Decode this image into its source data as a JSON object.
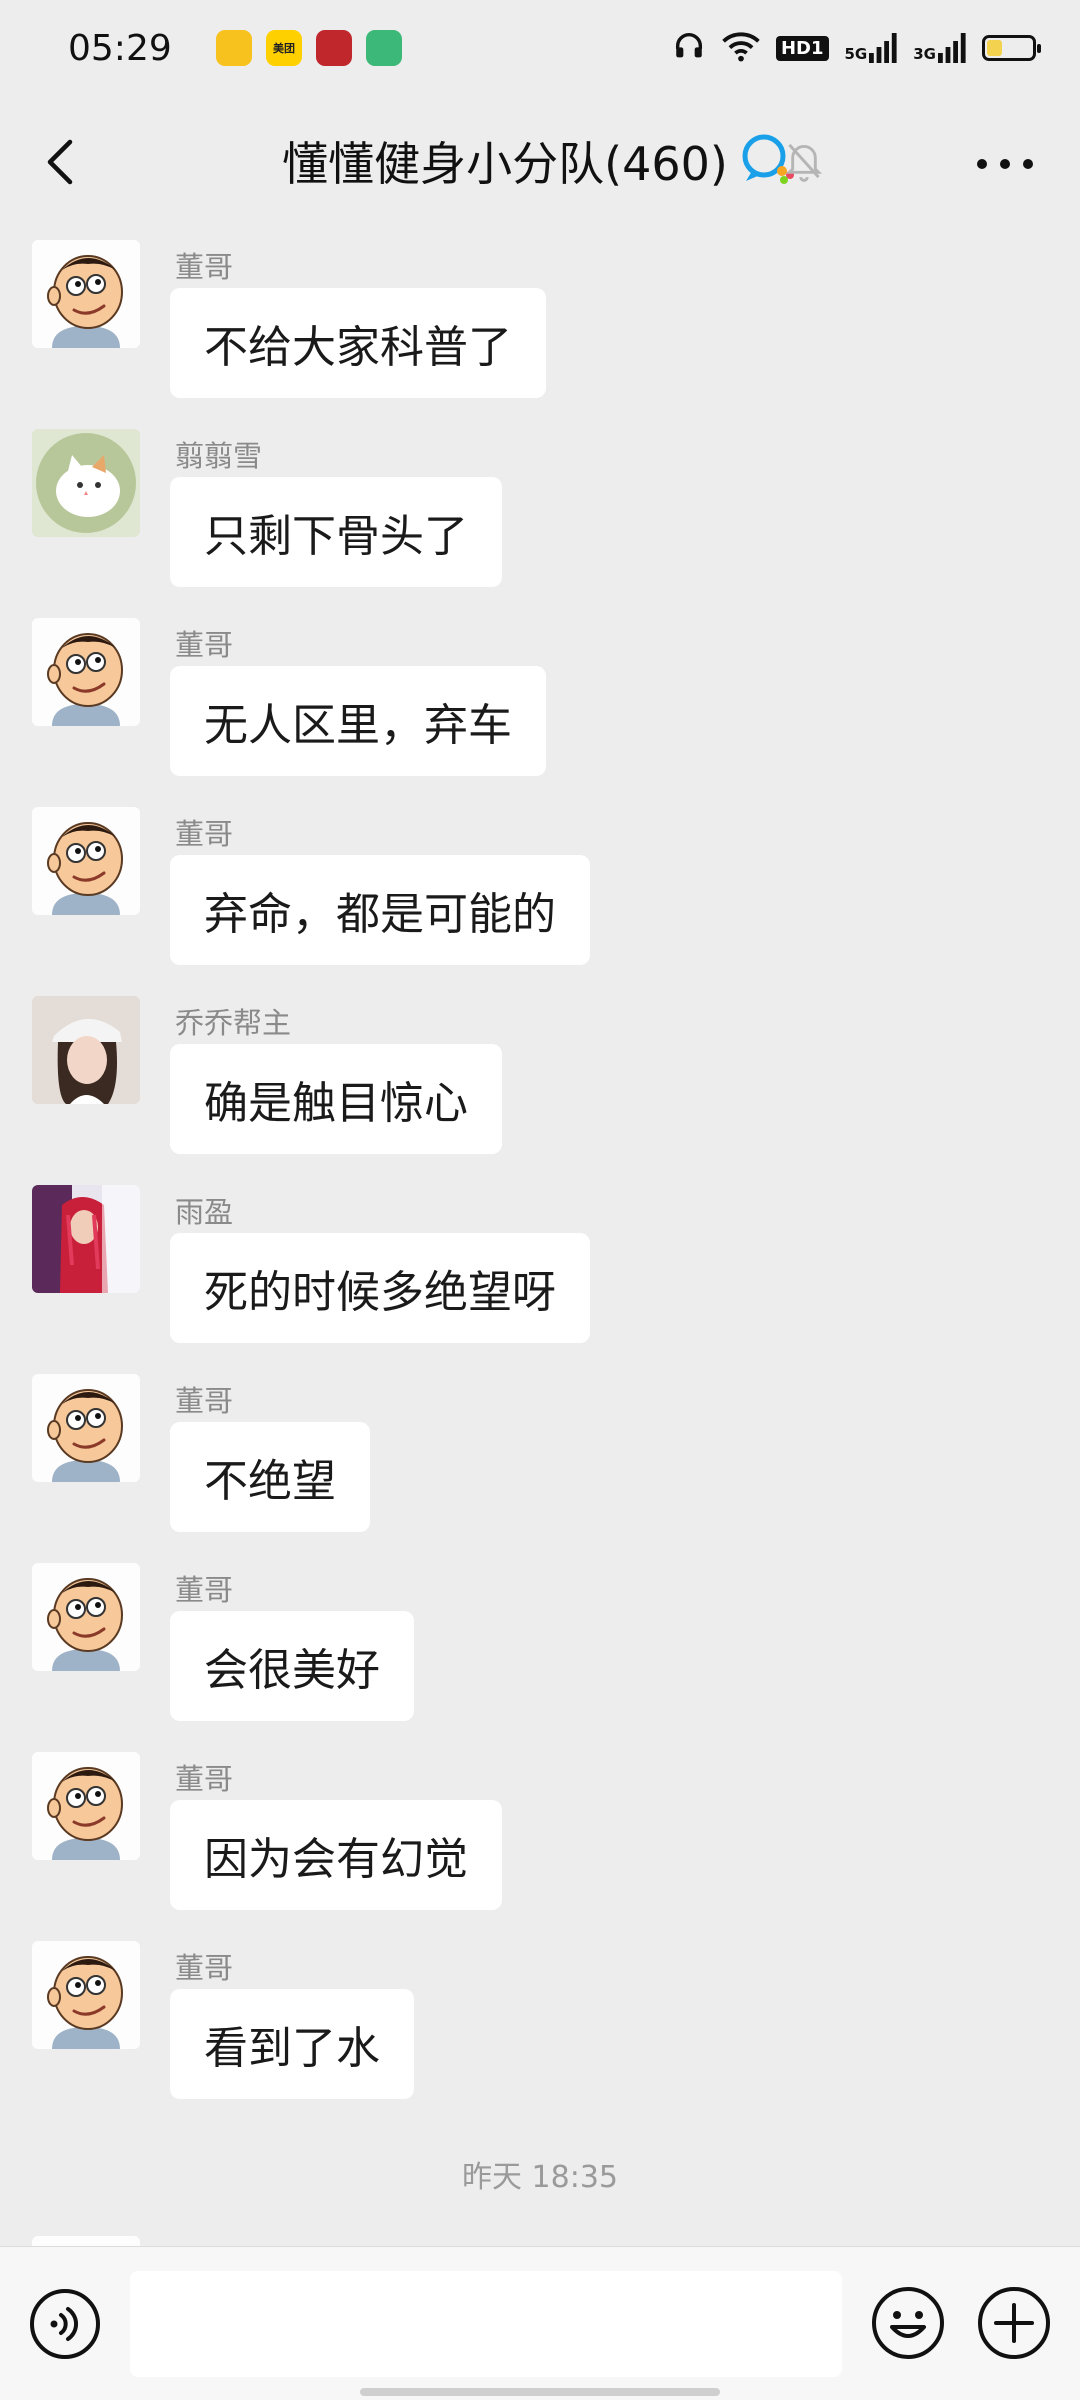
{
  "status_bar": {
    "time": "05:29",
    "app_icons": [
      {
        "name": "notify-app-icon",
        "color": "#f7c21e",
        "label": ""
      },
      {
        "name": "meituan-app-icon",
        "color": "#ffd000",
        "label": "美团"
      },
      {
        "name": "bank-app-icon",
        "color": "#c0272d",
        "label": ""
      },
      {
        "name": "green-app-icon",
        "color": "#3cb878",
        "label": ""
      }
    ],
    "hd_label": "HD1",
    "signal_5g": "5G",
    "signal_3g": "3G",
    "battery_level": 0.35
  },
  "header": {
    "title": "懂懂健身小分队(460)"
  },
  "messages": [
    {
      "sender": "董哥",
      "text": "不给大家科普了",
      "avatar": "cartoon-boy"
    },
    {
      "sender": "翦翦雪",
      "text": "只剩下骨头了",
      "avatar": "cat"
    },
    {
      "sender": "董哥",
      "text": "无人区里，弃车",
      "avatar": "cartoon-boy"
    },
    {
      "sender": "董哥",
      "text": "弃命，都是可能的",
      "avatar": "cartoon-boy"
    },
    {
      "sender": "乔乔帮主",
      "text": "确是触目惊心",
      "avatar": "girl-photo"
    },
    {
      "sender": "雨盈",
      "text": "死的时候多绝望呀",
      "avatar": "red-photo"
    },
    {
      "sender": "董哥",
      "text": "不绝望",
      "avatar": "cartoon-boy"
    },
    {
      "sender": "董哥",
      "text": "会很美好",
      "avatar": "cartoon-boy"
    },
    {
      "sender": "董哥",
      "text": "因为会有幻觉",
      "avatar": "cartoon-boy"
    },
    {
      "sender": "董哥",
      "text": "看到了水",
      "avatar": "cartoon-boy"
    }
  ],
  "timestamp": "昨天 18:35",
  "input": {
    "value": "",
    "placeholder": ""
  },
  "colors": {
    "background": "#ededed",
    "bubble": "#ffffff",
    "sender_text": "#8a8a8a",
    "input_bar": "#f7f7f7"
  }
}
